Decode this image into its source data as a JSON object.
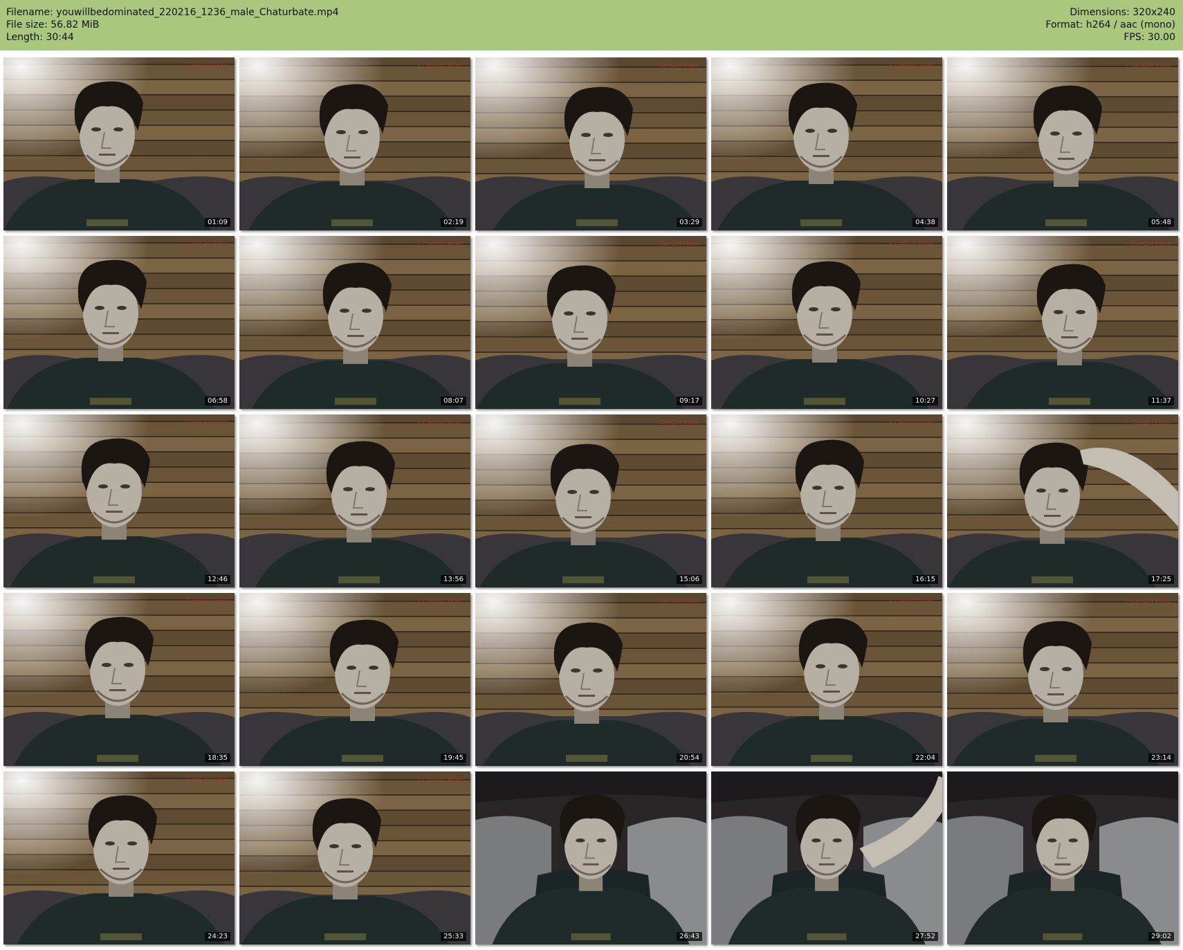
{
  "header": {
    "filename": "Filename: youwillbedominated_220216_1236_male_Chaturbate.mp4",
    "filesize": "File size: 56.82 MiB",
    "length": "Length: 30:44",
    "dimensions": "Dimensions: 320x240",
    "format": "Format: h264 / aac (mono)",
    "fps": "FPS: 30.00"
  },
  "colors": {
    "header_bg": "#aac77e"
  },
  "thumbnails": [
    {
      "timestamp": "01:09",
      "scene": "wall"
    },
    {
      "timestamp": "02:19",
      "scene": "wall"
    },
    {
      "timestamp": "03:29",
      "scene": "wall"
    },
    {
      "timestamp": "04:38",
      "scene": "wall"
    },
    {
      "timestamp": "05:48",
      "scene": "wall"
    },
    {
      "timestamp": "06:58",
      "scene": "wall"
    },
    {
      "timestamp": "08:07",
      "scene": "wall"
    },
    {
      "timestamp": "09:17",
      "scene": "wall"
    },
    {
      "timestamp": "10:27",
      "scene": "wall"
    },
    {
      "timestamp": "11:37",
      "scene": "wall"
    },
    {
      "timestamp": "12:46",
      "scene": "wall"
    },
    {
      "timestamp": "13:56",
      "scene": "wall"
    },
    {
      "timestamp": "15:06",
      "scene": "wall"
    },
    {
      "timestamp": "16:15",
      "scene": "wall"
    },
    {
      "timestamp": "17:25",
      "scene": "wall-arm"
    },
    {
      "timestamp": "18:35",
      "scene": "wall"
    },
    {
      "timestamp": "19:45",
      "scene": "wall"
    },
    {
      "timestamp": "20:54",
      "scene": "wall"
    },
    {
      "timestamp": "22:04",
      "scene": "wall"
    },
    {
      "timestamp": "23:14",
      "scene": "wall"
    },
    {
      "timestamp": "24:23",
      "scene": "wall"
    },
    {
      "timestamp": "25:33",
      "scene": "wall"
    },
    {
      "timestamp": "26:43",
      "scene": "bed"
    },
    {
      "timestamp": "27:52",
      "scene": "bed-arm"
    },
    {
      "timestamp": "29:02",
      "scene": "bed"
    }
  ]
}
